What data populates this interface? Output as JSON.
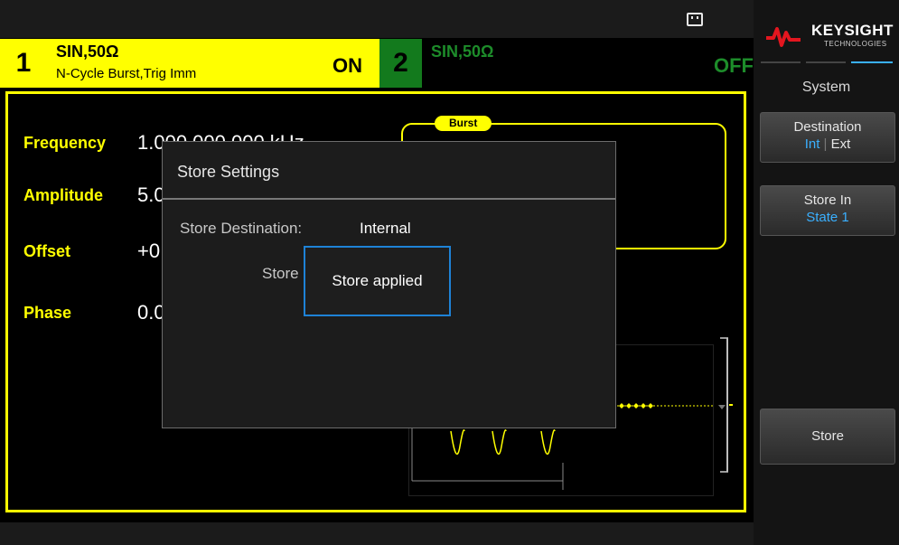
{
  "channel1": {
    "number": "1",
    "waveform": "SIN,50Ω",
    "mode": "N-Cycle Burst,Trig Imm",
    "state": "ON"
  },
  "channel2": {
    "number": "2",
    "waveform": "SIN,50Ω",
    "state": "OFF"
  },
  "params": [
    {
      "label": "Frequency",
      "value": "1.000,000,000 kHz"
    },
    {
      "label": "Amplitude",
      "value": "5.0"
    },
    {
      "label": "Offset",
      "value": "+0"
    },
    {
      "label": "Phase",
      "value": "0.0"
    }
  ],
  "burst": {
    "tag": "Burst"
  },
  "dialog": {
    "title": "Store Settings",
    "destination_label": "Store Destination:",
    "destination_value": "Internal",
    "store_label_partial": "Store",
    "toast": "Store applied"
  },
  "brand": {
    "name": "KEYSIGHT",
    "sub": "TECHNOLOGIES"
  },
  "menu": {
    "title": "System",
    "softkeys": {
      "destination": {
        "label": "Destination",
        "opt_int": "Int",
        "sep": "|",
        "opt_ext": "Ext"
      },
      "store_in": {
        "label": "Store In",
        "value": "State 1"
      },
      "store": {
        "label": "Store"
      }
    }
  },
  "colors": {
    "accent": "#ffff00",
    "channel2": "#1d8c2a",
    "highlight": "#3ab0ff",
    "toast_border": "#1e82d6"
  }
}
